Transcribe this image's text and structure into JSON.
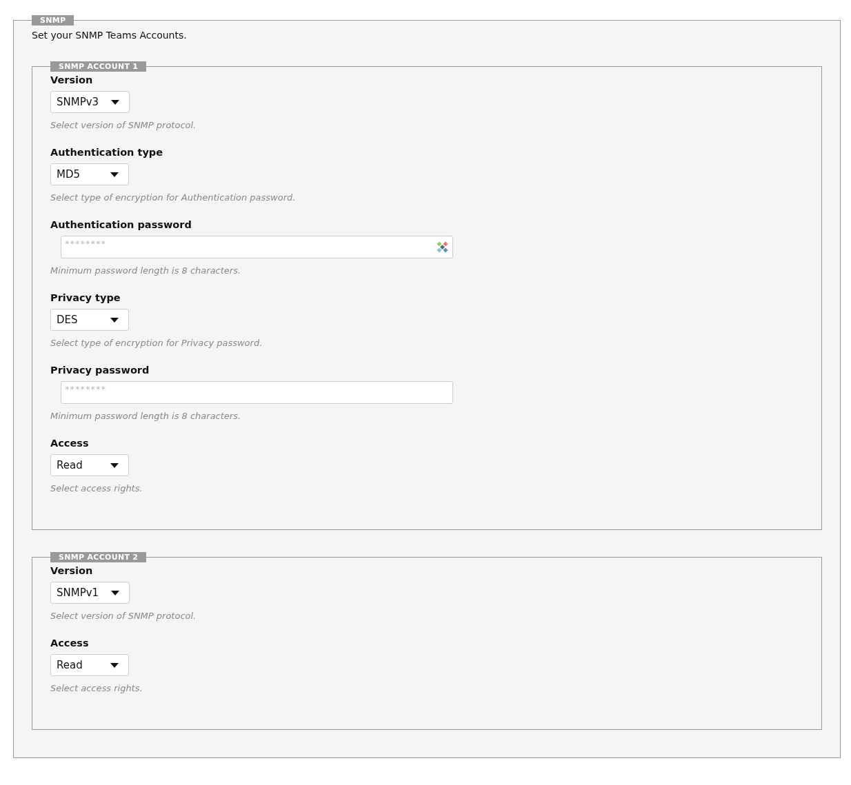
{
  "section": {
    "legend": "SNMP",
    "intro": "Set your SNMP Teams Accounts."
  },
  "accounts": [
    {
      "legend": "SNMP ACCOUNT 1",
      "fields": [
        {
          "kind": "select",
          "label": "Version",
          "value": "SNMPv3",
          "help": "Select version of SNMP protocol."
        },
        {
          "kind": "select",
          "label": "Authentication type",
          "value": "MD5",
          "help": "Select type of encryption for Authentication password."
        },
        {
          "kind": "password",
          "label": "Authentication password",
          "placeholder": "********",
          "manager_icon": true,
          "help": "Minimum password length is 8 characters."
        },
        {
          "kind": "select",
          "label": "Privacy type",
          "value": "DES",
          "help": "Select type of encryption for Privacy password."
        },
        {
          "kind": "password",
          "label": "Privacy password",
          "placeholder": "********",
          "manager_icon": false,
          "help": "Minimum password length is 8 characters."
        },
        {
          "kind": "select",
          "label": "Access",
          "value": "Read",
          "help": "Select access rights."
        }
      ]
    },
    {
      "legend": "SNMP ACCOUNT 2",
      "fields": [
        {
          "kind": "select",
          "label": "Version",
          "value": "SNMPv1",
          "help": "Select version of SNMP protocol."
        },
        {
          "kind": "select",
          "label": "Access",
          "value": "Read",
          "help": "Select access rights."
        }
      ]
    }
  ]
}
